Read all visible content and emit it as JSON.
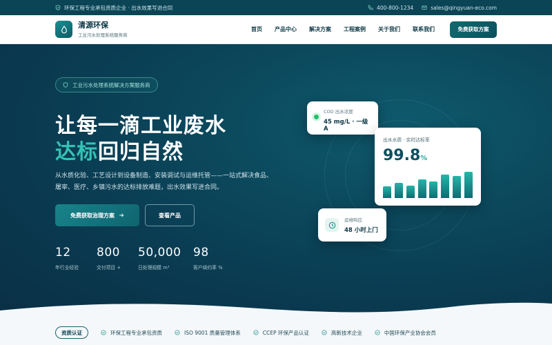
{
  "topbar": {
    "slogan": "环保工程专业承包资质企业 · 出水效果写进合同",
    "phone": "400-800-1234",
    "email": "sales@qingyuan-eco.com"
  },
  "header": {
    "brand_name": "清源环保",
    "brand_sub": "工业污水处理系统服务商",
    "nav": [
      "首页",
      "产品中心",
      "解决方案",
      "工程案例",
      "关于我们",
      "联系我们"
    ],
    "cta": "免费获取方案"
  },
  "hero": {
    "badge": "工业污水处理系统解决方案服务商",
    "title_line1": "让每一滴工业废水",
    "title_accent": "达标",
    "title_rest": "回归自然",
    "description": "从水质化验、工艺设计到设备制造、安装调试与运维托管——一站式解决食品、屠宰、医疗、乡镇污水的达标排放难题，出水效果写进合同。",
    "primary_button": "免费获取治理方案",
    "secondary_button": "查看产品",
    "stats": [
      {
        "value": "12",
        "label": "年行业经验"
      },
      {
        "value": "800",
        "label": "交付项目 +"
      },
      {
        "value": "50,000",
        "label": "日处理规模 m³"
      },
      {
        "value": "98",
        "label": "客户续约率 %"
      }
    ]
  },
  "cards": {
    "cod": {
      "title": "COD 出水浓度",
      "value": "45 mg/L · 一级A"
    },
    "quality": {
      "title": "出水水质 · 实时达标率",
      "value": "99.8",
      "unit": "%",
      "bars": [
        0.38,
        0.5,
        0.4,
        0.62,
        0.55,
        0.78,
        0.72,
        0.86
      ]
    },
    "response": {
      "title": "运维响应",
      "value": "48 小时上门"
    }
  },
  "certs": {
    "tag": "资质认证",
    "items": [
      "环保工程专业承包资质",
      "ISO 9001 质量管理体系",
      "CCEP 环保产品认证",
      "高新技术企业",
      "中国环保产业协会会员"
    ]
  },
  "colors": {
    "accent": "#34c3b6",
    "dark": "#0a3c52",
    "brand": "#0f6b6f"
  }
}
